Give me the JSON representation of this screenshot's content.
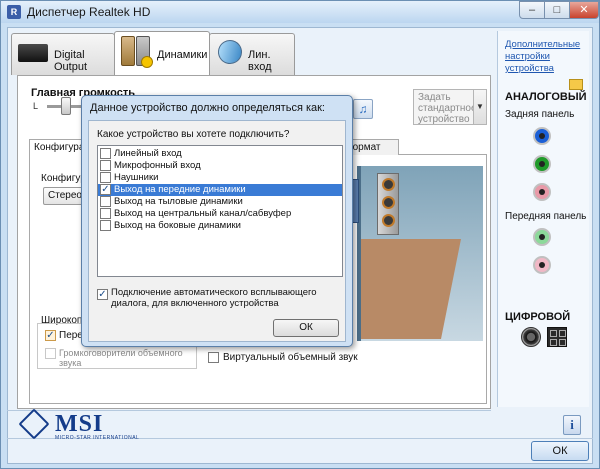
{
  "window": {
    "title": "Диспетчер Realtek HD",
    "min": "–",
    "max": "□",
    "close": "✕"
  },
  "tabs": [
    {
      "label": "Digital Output"
    },
    {
      "label": "Динамики"
    },
    {
      "label": "Лин. вход"
    }
  ],
  "main": {
    "volume_label": "Главная громкость",
    "left_letter": "L",
    "preset_text": "Задать стандартное устройство",
    "preset_arrow": "▼",
    "speaker_icon": "♫",
    "subtab_config": "Конфигура",
    "subtab_format": "й формат",
    "config_label": "Конфигура",
    "config_value": "Стереофо",
    "wide_label": "Широкопол",
    "wide_option1": "Перед",
    "wide_option2": "Громкоговорители объемного звука",
    "virtual_surround": "Виртуальный объемный звук"
  },
  "right": {
    "link": "Дополнительные настройки устройства",
    "analog": "АНАЛОГОВЫЙ",
    "rear": "Задняя панель",
    "front": "Передняя панель",
    "digital": "ЦИФРОВОЙ",
    "jack_colors": {
      "rear_blue": "#1a5fd6",
      "rear_green": "#1f9a2a",
      "rear_pink": "#e89aa8",
      "front_green": "#8cd99a",
      "front_pink": "#f0b8c6"
    }
  },
  "footer": {
    "logo_word": "MSI",
    "logo_sub": "MICRO-STAR INTERNATIONAL",
    "info_icon": "i",
    "ok": "ОК"
  },
  "dialog": {
    "title": "Данное устройство должно определяться как:",
    "question": "Какое устройство вы хотете подключить?",
    "items": [
      {
        "label": "Линейный вход",
        "checked": false,
        "selected": false
      },
      {
        "label": "Микрофонный вход",
        "checked": false,
        "selected": false
      },
      {
        "label": "Наушники",
        "checked": false,
        "selected": false
      },
      {
        "label": "Выход на передние динамики",
        "checked": true,
        "selected": true
      },
      {
        "label": "Выход на тыловые динамики",
        "checked": false,
        "selected": false
      },
      {
        "label": "Выход на центральный канал/сабвуфер",
        "checked": false,
        "selected": false
      },
      {
        "label": "Выход на боковые динамики",
        "checked": false,
        "selected": false
      }
    ],
    "auto_popup": "Подключение автоматического всплывающего диалога, для включенного устройства",
    "auto_popup_checked": true,
    "ok": "ОК"
  }
}
